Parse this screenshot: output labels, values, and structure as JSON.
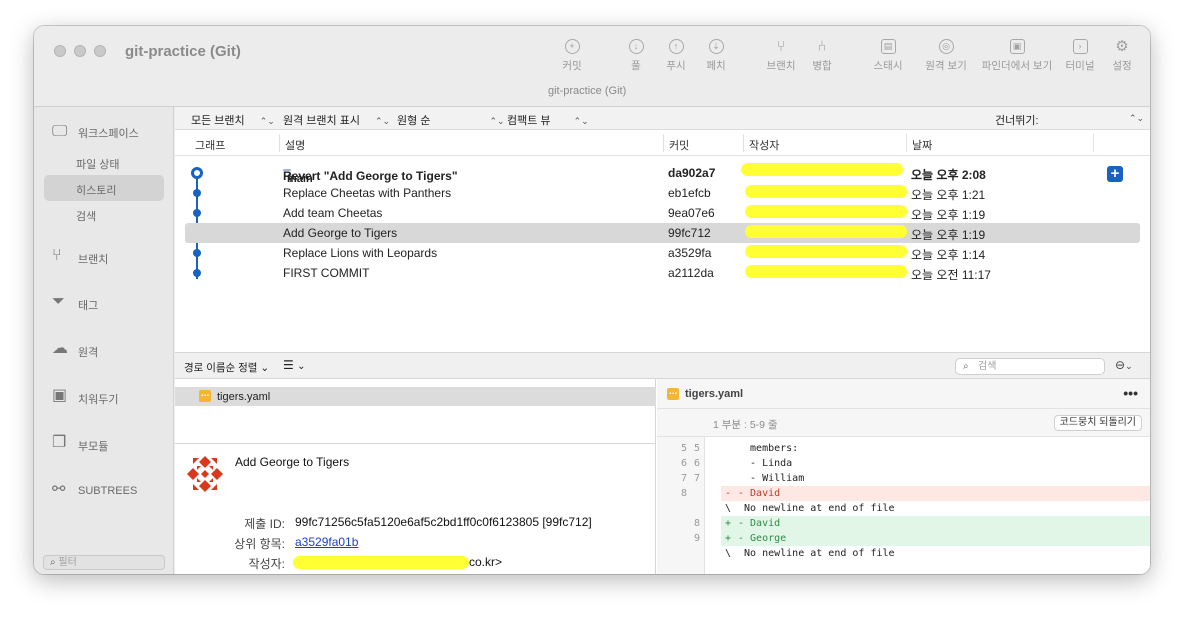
{
  "window": {
    "title": "git-practice (Git)",
    "subtitle": "git-practice (Git)"
  },
  "toolbar": [
    {
      "label": "커밋",
      "icon": "plus-circle-icon"
    },
    {
      "label": "풀",
      "icon": "arrow-down-circle-icon"
    },
    {
      "label": "푸시",
      "icon": "arrow-up-circle-icon"
    },
    {
      "label": "페치",
      "icon": "fetch-icon"
    },
    {
      "label": "브랜치",
      "icon": "branch-icon"
    },
    {
      "label": "병합",
      "icon": "merge-icon"
    },
    {
      "label": "스태시",
      "icon": "stash-icon"
    },
    {
      "label": "원격 보기",
      "icon": "globe-icon"
    },
    {
      "label": "파인더에서 보기",
      "icon": "finder-icon"
    },
    {
      "label": "터미널",
      "icon": "terminal-icon"
    },
    {
      "label": "설정",
      "icon": "gear-icon"
    }
  ],
  "sidebar": {
    "workspace": "워크스페이스",
    "file_status": "파일 상태",
    "history": "히스토리",
    "search": "검색",
    "branches": "브랜치",
    "tags": "태그",
    "remotes": "원격",
    "stashes": "치워두기",
    "submodules": "부모듈",
    "subtrees": "SUBTREES",
    "filter_placeholder": "필터"
  },
  "history_toolbar": {
    "all_branches": "모든 브랜치",
    "show_remote": "원격 브랜치 표시",
    "order": "원형 순",
    "compact": "컴팩트 뷰",
    "jump": "건너뛰기:"
  },
  "columns": {
    "graph": "그래프",
    "description": "설명",
    "commit": "커밋",
    "author": "작성자",
    "date": "날짜"
  },
  "commits": [
    {
      "branch": "main",
      "message": "Revert \"Add George to Tigers\"",
      "hash": "da902a7",
      "date": "오늘 오후 2:08"
    },
    {
      "message": "Replace Cheetas with Panthers",
      "hash": "eb1efcb",
      "date": "오늘 오후 1:21"
    },
    {
      "message": "Add team Cheetas",
      "hash": "9ea07e6",
      "date": "오늘 오후 1:19"
    },
    {
      "message": "Add George to Tigers",
      "hash": "99fc712",
      "date": "오늘 오후 1:19"
    },
    {
      "message": "Replace Lions with Leopards",
      "hash": "a3529fa",
      "date": "오늘 오후 1:14"
    },
    {
      "message": "FIRST COMMIT",
      "hash": "a2112da",
      "date": "오늘 오전 11:17"
    }
  ],
  "lower_bar": {
    "sort": "경로 이름순 정렬",
    "search_placeholder": "검색"
  },
  "files": {
    "selected": "tigers.yaml"
  },
  "commit_detail": {
    "message": "Add George to Tigers",
    "commit_id_label": "제출 ID:",
    "commit_id": "99fc71256c5fa5120e6af5c2bd1ff0c0f6123805 [99fc712]",
    "parent_label": "상위 항목:",
    "parent": "a3529fa01b",
    "author_label": "작성자:",
    "author_suffix": "co.kr>"
  },
  "diff": {
    "file": "tigers.yaml",
    "hunk": "1 부분 : 5-9 줄",
    "revert_hunk": "코드뭉치 되돌리기",
    "lines": [
      {
        "old": "5",
        "new": "5",
        "mark": "",
        "text": "  members:",
        "kind": "ctx"
      },
      {
        "old": "6",
        "new": "6",
        "mark": "",
        "text": "  - Linda",
        "kind": "ctx"
      },
      {
        "old": "7",
        "new": "7",
        "mark": "",
        "text": "  - William",
        "kind": "ctx"
      },
      {
        "old": "8",
        "new": "",
        "mark": "-",
        "text": "- David",
        "kind": "del"
      },
      {
        "old": "",
        "new": "",
        "mark": "\\",
        "text": " No newline at end of file",
        "kind": "ctx"
      },
      {
        "old": "",
        "new": "8",
        "mark": "+",
        "text": "- David",
        "kind": "add"
      },
      {
        "old": "",
        "new": "9",
        "mark": "+",
        "text": "- George",
        "kind": "add"
      },
      {
        "old": "",
        "new": "",
        "mark": "\\",
        "text": " No newline at end of file",
        "kind": "ctx"
      }
    ]
  },
  "colors": {
    "graph_blue": "#1862c2",
    "redaction_yellow": "#ffff33",
    "added_bg": "#e2f6e8",
    "removed_bg": "#fde8e4"
  }
}
